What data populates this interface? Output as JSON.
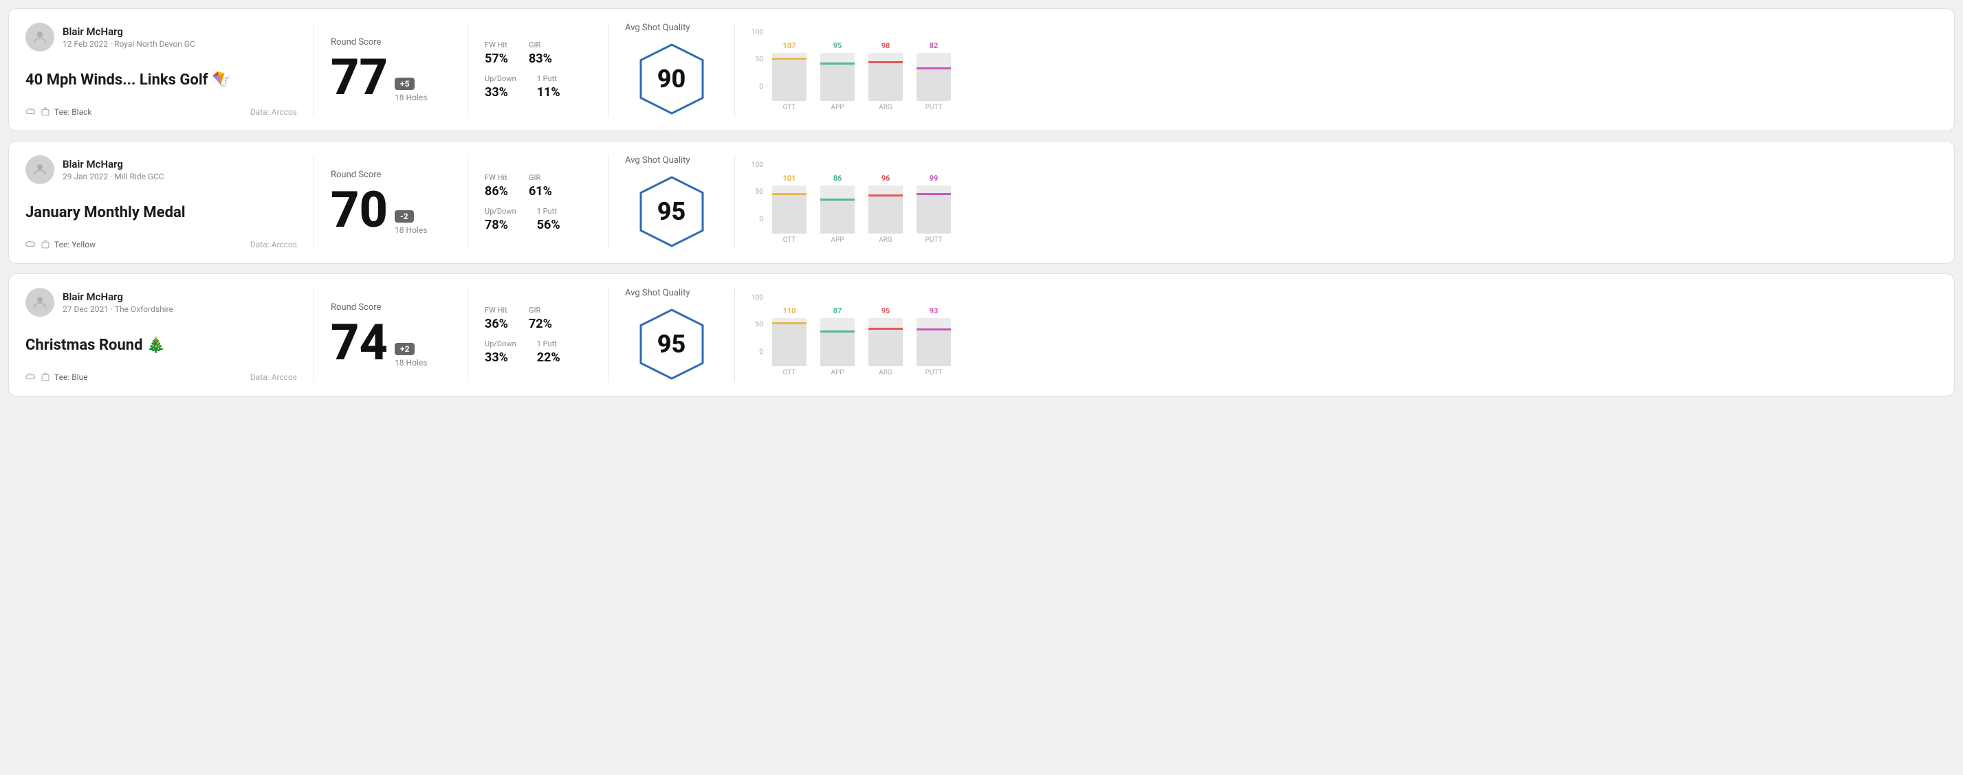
{
  "rounds": [
    {
      "id": "round1",
      "user_name": "Blair McHarg",
      "user_meta": "12 Feb 2022 · Royal North Devon GC",
      "round_title": "40 Mph Winds... Links Golf 🪁",
      "tee": "Black",
      "data_source": "Data: Arccos",
      "score": "77",
      "score_modifier": "+5",
      "holes": "18 Holes",
      "fw_hit": "57%",
      "gir": "83%",
      "up_down": "33%",
      "one_putt": "11%",
      "avg_quality_score": "90",
      "chart": {
        "ott": {
          "value": 107,
          "pct": 85,
          "color": "#e8b84b"
        },
        "app": {
          "value": 95,
          "pct": 75,
          "color": "#4db89a"
        },
        "arg": {
          "value": 98,
          "pct": 78,
          "color": "#e05a5a"
        },
        "putt": {
          "value": 82,
          "pct": 65,
          "color": "#c45ab3"
        }
      }
    },
    {
      "id": "round2",
      "user_name": "Blair McHarg",
      "user_meta": "29 Jan 2022 · Mill Ride GCC",
      "round_title": "January Monthly Medal",
      "tee": "Yellow",
      "data_source": "Data: Arccos",
      "score": "70",
      "score_modifier": "-2",
      "holes": "18 Holes",
      "fw_hit": "86%",
      "gir": "61%",
      "up_down": "78%",
      "one_putt": "56%",
      "avg_quality_score": "95",
      "chart": {
        "ott": {
          "value": 101,
          "pct": 80,
          "color": "#e8b84b"
        },
        "app": {
          "value": 86,
          "pct": 68,
          "color": "#4db89a"
        },
        "arg": {
          "value": 96,
          "pct": 76,
          "color": "#e05a5a"
        },
        "putt": {
          "value": 99,
          "pct": 79,
          "color": "#c45ab3"
        }
      }
    },
    {
      "id": "round3",
      "user_name": "Blair McHarg",
      "user_meta": "27 Dec 2021 · The Oxfordshire",
      "round_title": "Christmas Round 🎄",
      "tee": "Blue",
      "data_source": "Data: Arccos",
      "score": "74",
      "score_modifier": "+2",
      "holes": "18 Holes",
      "fw_hit": "36%",
      "gir": "72%",
      "up_down": "33%",
      "one_putt": "22%",
      "avg_quality_score": "95",
      "chart": {
        "ott": {
          "value": 110,
          "pct": 87,
          "color": "#e8b84b"
        },
        "app": {
          "value": 87,
          "pct": 69,
          "color": "#4db89a"
        },
        "arg": {
          "value": 95,
          "pct": 75,
          "color": "#e05a5a"
        },
        "putt": {
          "value": 93,
          "pct": 74,
          "color": "#c45ab3"
        }
      }
    }
  ],
  "labels": {
    "round_score": "Round Score",
    "fw_hit": "FW Hit",
    "gir": "GIR",
    "up_down": "Up/Down",
    "one_putt": "1 Putt",
    "avg_quality": "Avg Shot Quality",
    "ott": "OTT",
    "app": "APP",
    "arg": "ARG",
    "putt": "PUTT",
    "tee_prefix": "Tee: ",
    "data_arccos": "Data: Arccos",
    "chart_100": "100",
    "chart_50": "50",
    "chart_0": "0"
  }
}
